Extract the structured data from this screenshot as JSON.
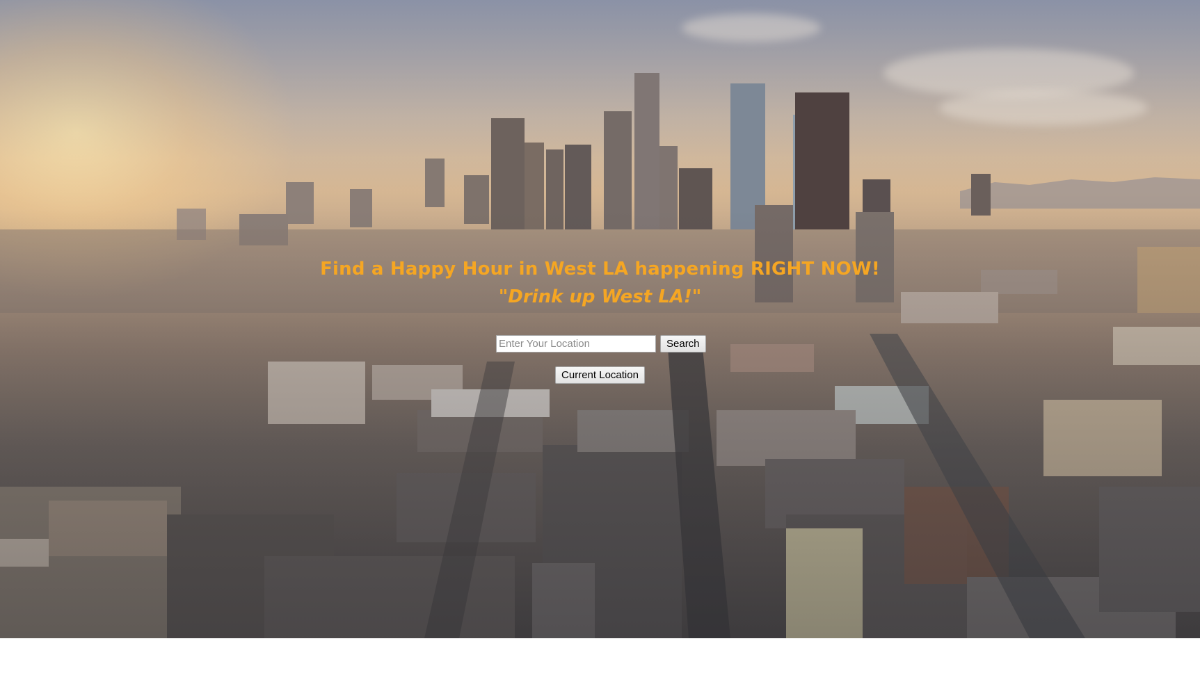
{
  "hero": {
    "headline": "Find a Happy Hour in West LA happening RIGHT NOW!",
    "tagline": "\"Drink up West LA!\"",
    "text_color": "#f5a623"
  },
  "search": {
    "placeholder": "Enter Your Location",
    "value": "",
    "button_label": "Search"
  },
  "current_location": {
    "button_label": "Current Location"
  },
  "background": {
    "description_icon": "city-skyline-image",
    "page_color": "#ffffff"
  }
}
